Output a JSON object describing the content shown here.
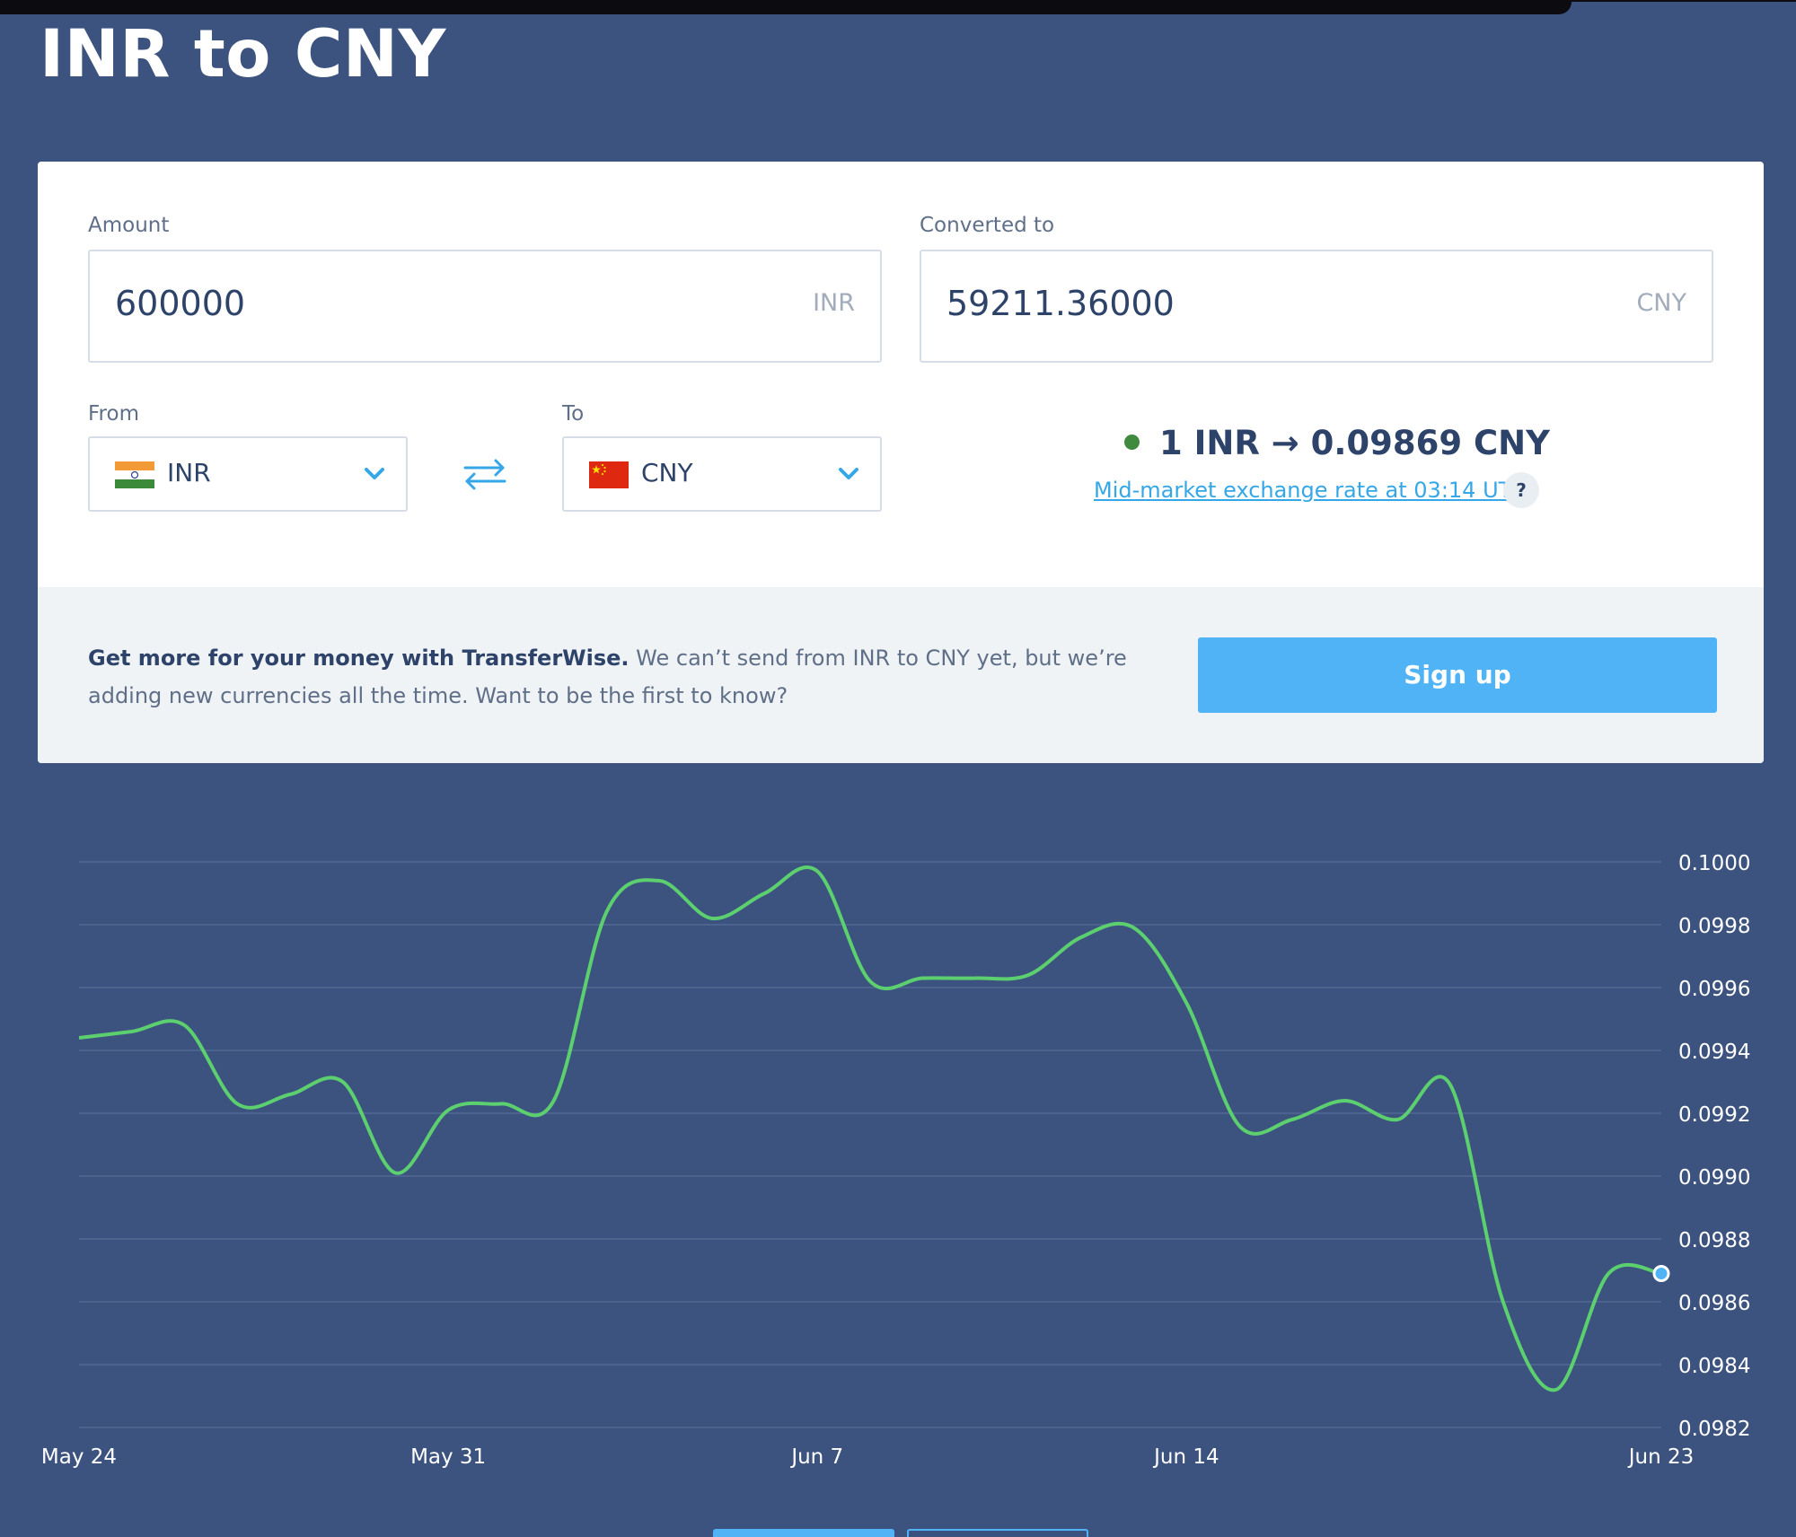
{
  "page": {
    "title": "INR to CNY"
  },
  "converter": {
    "amount_label": "Amount",
    "amount_value": "600000",
    "amount_currency": "INR",
    "converted_label": "Converted to",
    "converted_value": "59211.36000",
    "converted_currency": "CNY",
    "from_label": "From",
    "from_currency": "INR",
    "to_label": "To",
    "to_currency": "CNY",
    "rate_text": "1 INR → 0.09869 CNY",
    "rate_link": "Mid-market exchange rate at 03:14 UTC",
    "help": "?"
  },
  "promo": {
    "bold_text": "Get more for your money with TransferWise.",
    "text": " We can’t send from INR to CNY yet, but we’re adding new currencies all the time. Want to be the first to know?",
    "signup_label": "Sign up"
  },
  "colors": {
    "background": "#3c537f",
    "line": "#5ccf6f",
    "accent": "#4fb3f6",
    "rate_dot": "#3f8a3e"
  },
  "chart_data": {
    "type": "line",
    "x": [
      "May 24",
      "May 25",
      "May 26",
      "May 27",
      "May 28",
      "May 29",
      "May 30",
      "May 31",
      "Jun 1",
      "Jun 2",
      "Jun 3",
      "Jun 4",
      "Jun 5",
      "Jun 6",
      "Jun 7",
      "Jun 8",
      "Jun 9",
      "Jun 10",
      "Jun 11",
      "Jun 12",
      "Jun 13",
      "Jun 14",
      "Jun 15",
      "Jun 16",
      "Jun 17",
      "Jun 18",
      "Jun 19",
      "Jun 20",
      "Jun 21",
      "Jun 22",
      "Jun 23"
    ],
    "values": [
      0.09944,
      0.09946,
      0.09948,
      0.09923,
      0.09926,
      0.0993,
      0.09901,
      0.09921,
      0.09923,
      0.09924,
      0.09984,
      0.09994,
      0.09982,
      0.0999,
      0.09997,
      0.09962,
      0.09963,
      0.09963,
      0.09964,
      0.09976,
      0.09979,
      0.09955,
      0.09916,
      0.09918,
      0.09924,
      0.09918,
      0.09929,
      0.0986,
      0.09832,
      0.09869,
      0.09869
    ],
    "x_ticks": [
      "May 24",
      "May 31",
      "Jun 7",
      "Jun 14",
      "Jun 23"
    ],
    "y_ticks": [
      "0.1000",
      "0.0998",
      "0.0996",
      "0.0994",
      "0.0992",
      "0.0990",
      "0.0988",
      "0.0986",
      "0.0984",
      "0.0982"
    ],
    "ylim": [
      0.0982,
      0.1
    ],
    "grid": true,
    "title": "",
    "xlabel": "",
    "ylabel": ""
  }
}
